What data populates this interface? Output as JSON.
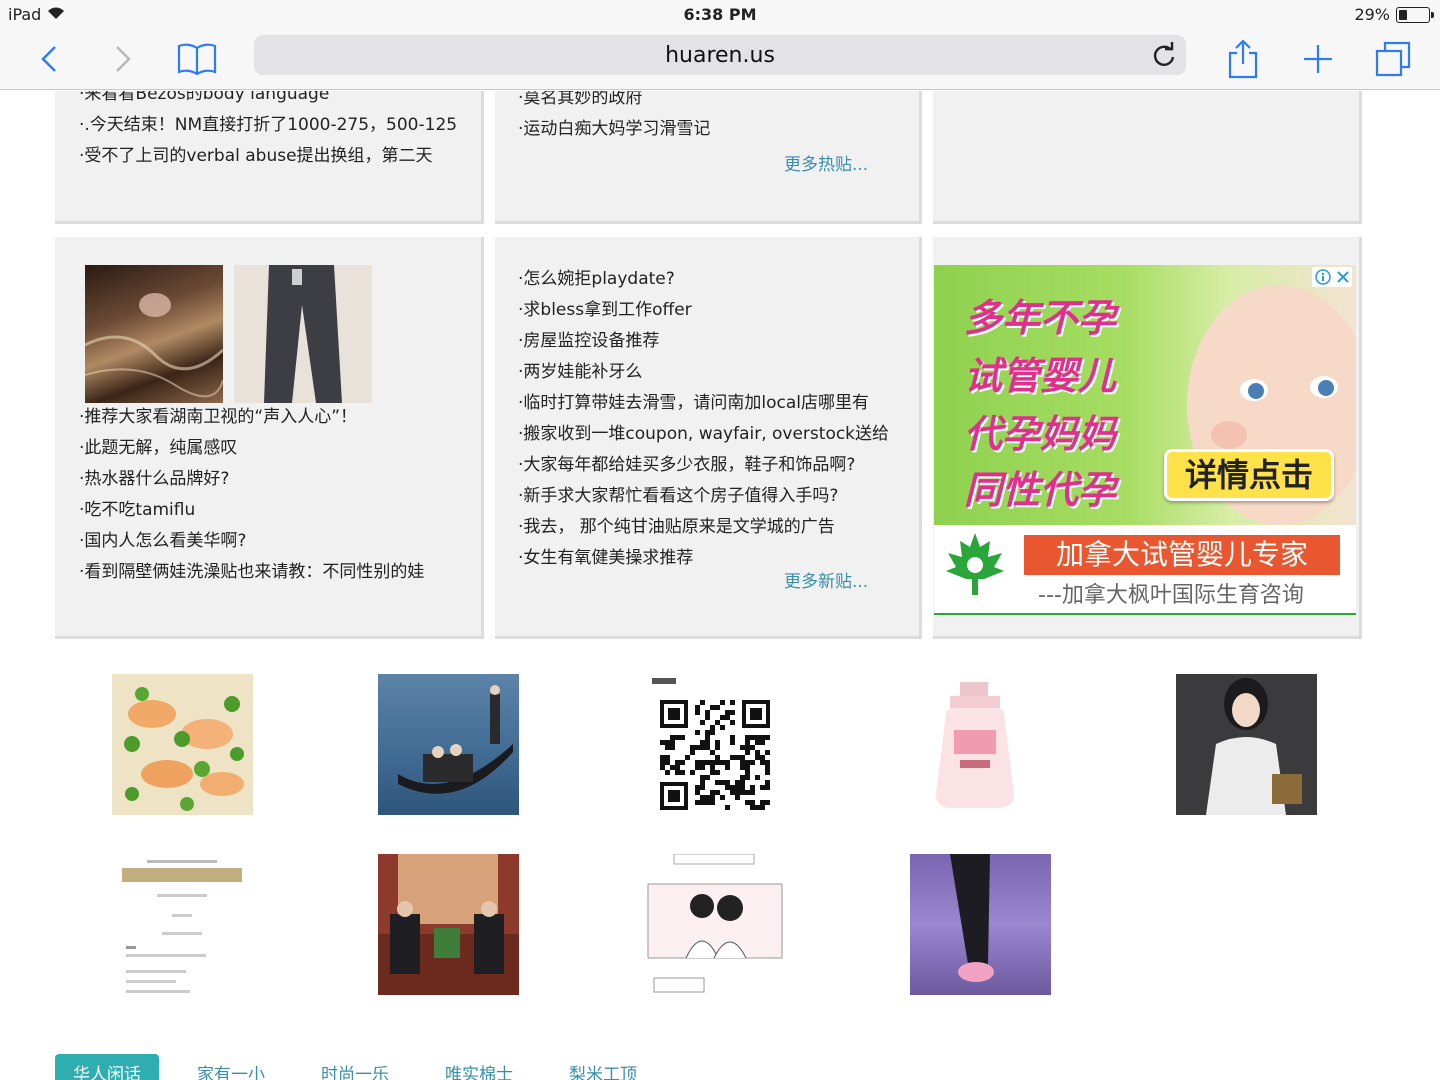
{
  "status": {
    "device": "iPad",
    "time": "6:38 PM",
    "battery": "29%",
    "battery_level": 0.29
  },
  "browser": {
    "url": "huaren.us"
  },
  "panels": {
    "hot_posts": {
      "items": [
        "来看看Bezos的body language",
        ".今天结束！NM直接打折了1000-275，500-125",
        "受不了上司的verbal abuse提出换组，第二天"
      ]
    },
    "hot_posts_2": {
      "items": [
        "莫名其妙的政府",
        "运动白痴大妈学习滑雪记"
      ],
      "more": "更多热贴..."
    },
    "featured": {
      "items": [
        "推荐大家看湖南卫视的“声入人心”！",
        "此题无解，纯属感叹",
        "热水器什么品牌好?",
        "吃不吃tamiflu",
        "国内人怎么看美华啊?",
        "看到隔壁俩娃洗澡贴也来请教：不同性别的娃"
      ]
    },
    "new_posts": {
      "items": [
        "怎么婉拒playdate?",
        "求bless拿到工作offer",
        "房屋监控设备推荐",
        "两岁娃能补牙么",
        "临时打算带娃去滑雪，请问南加local店哪里有",
        "搬家收到一堆coupon, wayfair, overstock送给",
        "大家每年都给娃买多少衣服，鞋子和饰品啊?",
        "新手求大家帮忙看看这个房子值得入手吗?",
        "我去，  那个纯甘油贴原来是文学城的广告",
        "女生有氧健美操求推荐"
      ],
      "more": "更多新贴..."
    }
  },
  "ad": {
    "lines": [
      "多年不孕",
      "试管婴儿",
      "代孕妈妈",
      "同性代孕"
    ],
    "cta": "详情点击",
    "banner": "加拿大试管婴儿专家",
    "sub": "---加拿大枫叶国际生育咨询"
  },
  "tabs": [
    "华人闲话",
    "家有一小",
    "时尚一乐",
    "唯实棉士",
    "梨米工顶"
  ],
  "colors": {
    "link": "#3a8fa8",
    "tab_active": "#2eaeb0",
    "panel_bg": "#f1f1f1",
    "ios_blue": "#2d7cf6"
  }
}
